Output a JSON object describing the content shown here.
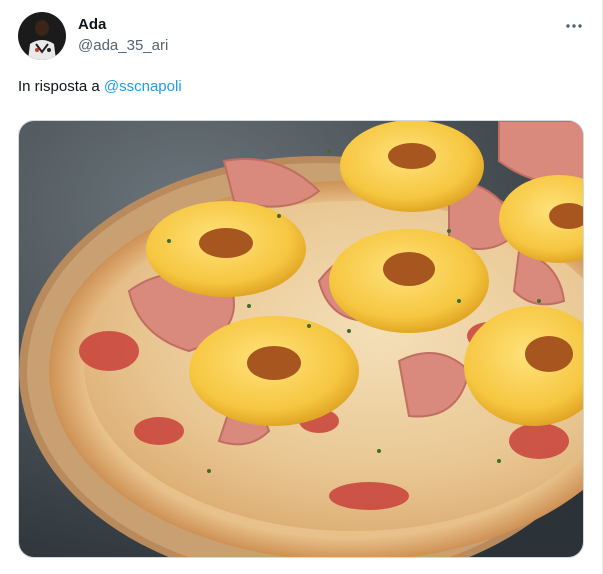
{
  "tweet": {
    "author": {
      "display_name": "Ada",
      "handle": "@ada_35_ari"
    },
    "reply_prefix": "In risposta a",
    "reply_mention": "@sscnapoli",
    "more_icon": "more-horizontal-icon",
    "media": {
      "type": "photo",
      "description_icon": "pizza-photo"
    }
  },
  "colors": {
    "text_primary": "#0f1419",
    "text_secondary": "#536471",
    "link": "#1d9bf0",
    "border": "#cfd9de"
  }
}
